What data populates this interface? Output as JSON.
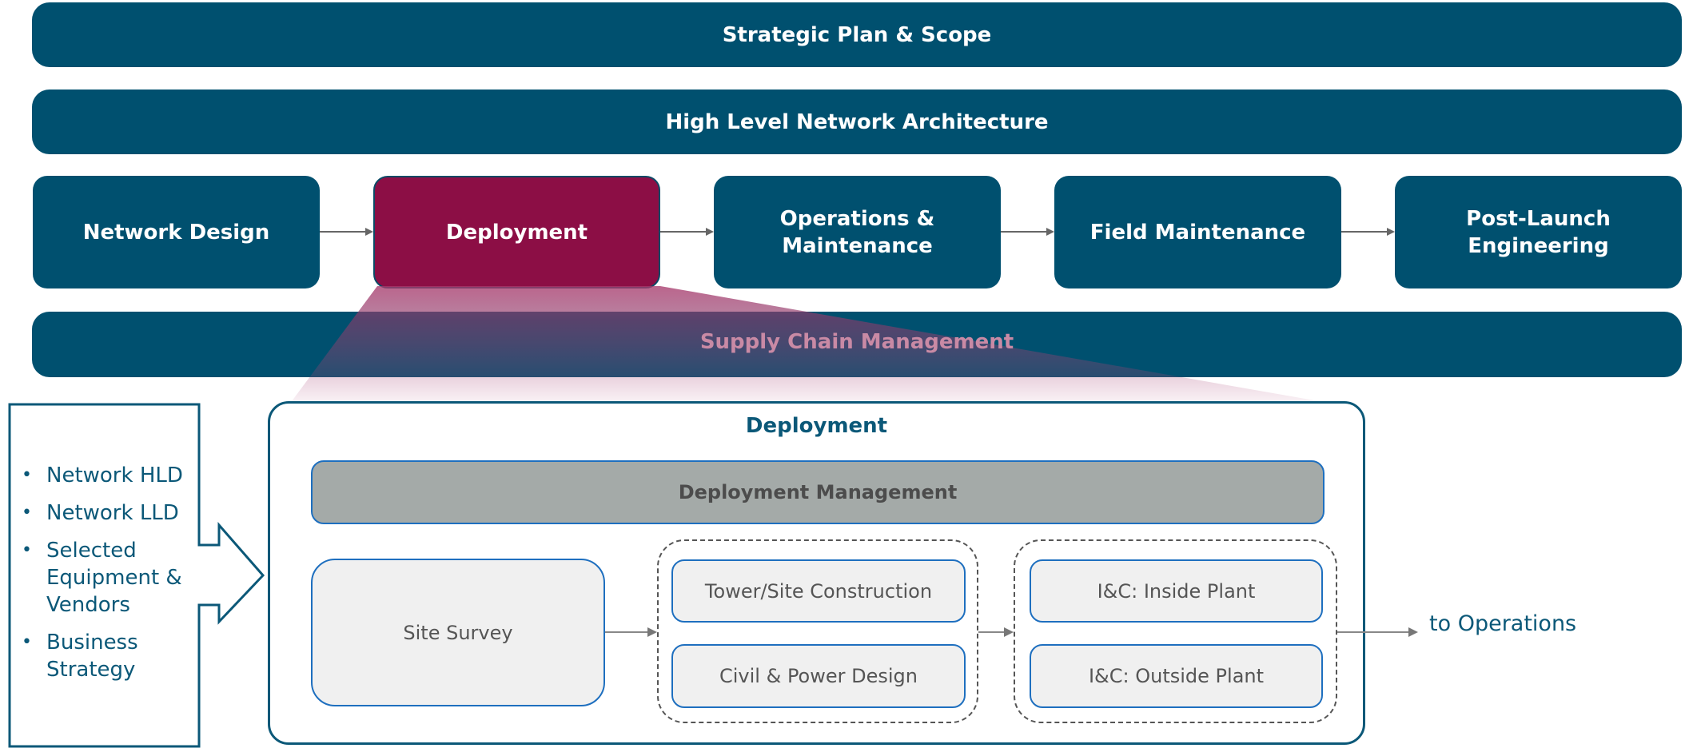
{
  "top_bars": {
    "strategic": "Strategic Plan & Scope",
    "architecture": "High Level Network Architecture"
  },
  "stages": [
    {
      "label": "Network Design",
      "active": false
    },
    {
      "label": "Deployment",
      "active": true
    },
    {
      "label": "Operations &\nMaintenance",
      "active": false
    },
    {
      "label": "Field Maintenance",
      "active": false
    },
    {
      "label": "Post-Launch\nEngineering",
      "active": false
    }
  ],
  "supply_chain": "Supply Chain Management",
  "inputs": {
    "items": [
      "Network HLD",
      "Network LLD",
      "Selected\nEquipment &\nVendors",
      "Business\nStrategy"
    ]
  },
  "deployment_panel": {
    "title": "Deployment",
    "management": "Deployment Management",
    "site_survey": "Site Survey",
    "group1": [
      "Tower/Site Construction",
      "Civil & Power Design"
    ],
    "group2": [
      "I&C: Inside Plant",
      "I&C: Outside Plant"
    ],
    "output_label": "to Operations"
  },
  "colors": {
    "primary": "#00506f",
    "active": "#8c0e45",
    "management": "#a4aaa8",
    "sub_border": "#1e6fbf"
  }
}
